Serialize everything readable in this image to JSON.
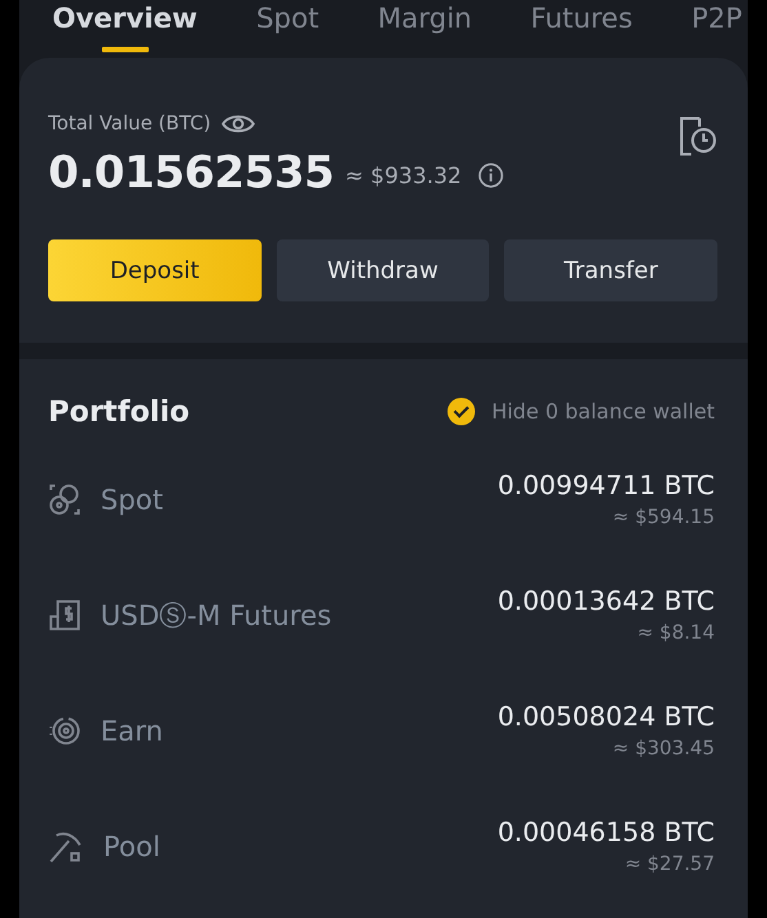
{
  "tabs": [
    {
      "label": "Overview",
      "selected": true
    },
    {
      "label": "Spot",
      "selected": false
    },
    {
      "label": "Margin",
      "selected": false
    },
    {
      "label": "Futures",
      "selected": false
    },
    {
      "label": "P2P",
      "selected": false
    }
  ],
  "balance": {
    "label": "Total Value (BTC)",
    "amount": "0.01562535",
    "approx": "≈ $933.32"
  },
  "buttons": [
    {
      "label": "Deposit",
      "kind": "primary"
    },
    {
      "label": "Withdraw",
      "kind": "secondary"
    },
    {
      "label": "Transfer",
      "kind": "secondary"
    }
  ],
  "portfolio": {
    "title": "Portfolio",
    "hide_zero": {
      "label": "Hide 0 balance wallet",
      "checked": true
    },
    "items": [
      {
        "kind": "spot",
        "name": "Spot",
        "amount": "0.00994711 BTC",
        "approx": "≈ $594.15"
      },
      {
        "kind": "futures",
        "name": "USDⓈ-M Futures",
        "amount": "0.00013642 BTC",
        "approx": "≈ $8.14"
      },
      {
        "kind": "earn",
        "name": "Earn",
        "amount": "0.00508024 BTC",
        "approx": "≈ $303.45"
      },
      {
        "kind": "pool",
        "name": "Pool",
        "amount": "0.00046158 BTC",
        "approx": "≈ $27.57"
      }
    ]
  }
}
